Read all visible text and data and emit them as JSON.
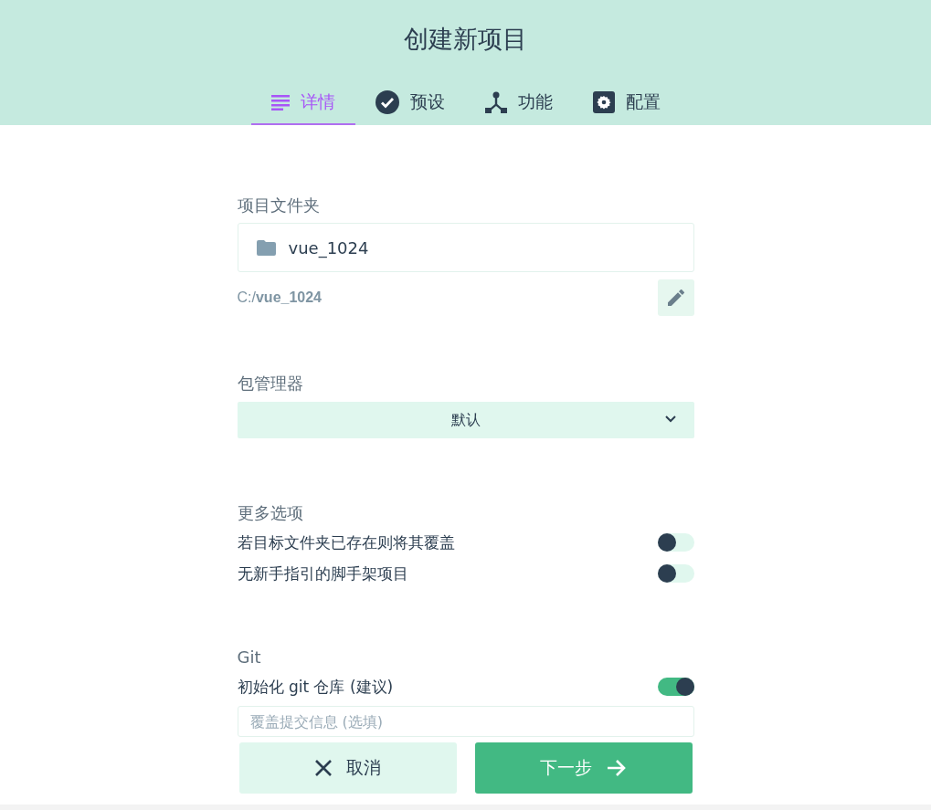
{
  "title": "创建新项目",
  "tabs": [
    {
      "label": "详情",
      "kind": "details",
      "selected": true
    },
    {
      "label": "预设",
      "kind": "check",
      "selected": false
    },
    {
      "label": "功能",
      "kind": "fork",
      "selected": false
    },
    {
      "label": "配置",
      "kind": "gear",
      "selected": false
    }
  ],
  "folder": {
    "label": "项目文件夹",
    "value": "vue_1024",
    "path": "C:/**vue_1024**"
  },
  "package_manager": {
    "label": "包管理器",
    "value": "默认"
  },
  "more_options": {
    "label": "更多选项",
    "options": [
      {
        "label": "若目标文件夹已存在则将其覆盖",
        "on": false
      },
      {
        "label": "无新手指引的脚手架项目",
        "on": false
      }
    ]
  },
  "git": {
    "label": "Git",
    "options": [
      {
        "label": "初始化 git 仓库 (建议)",
        "on": true
      }
    ],
    "placeholder": "覆盖提交信息 (选填)"
  },
  "buttons": [
    {
      "label": "取消",
      "kind": "cancel"
    },
    {
      "label": "下一步",
      "kind": "next"
    }
  ]
}
